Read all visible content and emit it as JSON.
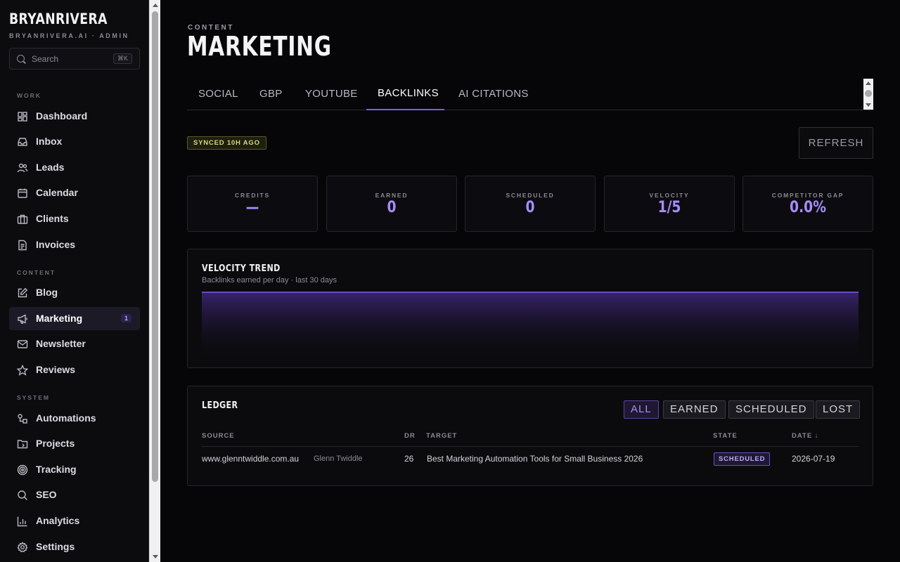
{
  "sidebar": {
    "brand": "BRYANRIVERA",
    "brand_sub": "BRYANRIVERA.AI · ADMIN",
    "search": {
      "placeholder": "Search",
      "shortcut": "⌘K"
    },
    "sections": [
      {
        "label": "WORK",
        "items": [
          {
            "label": "Dashboard",
            "icon": "dashboard-icon"
          },
          {
            "label": "Inbox",
            "icon": "inbox-icon"
          },
          {
            "label": "Leads",
            "icon": "users-icon"
          },
          {
            "label": "Calendar",
            "icon": "calendar-icon"
          },
          {
            "label": "Clients",
            "icon": "briefcase-icon"
          },
          {
            "label": "Invoices",
            "icon": "document-icon"
          }
        ]
      },
      {
        "label": "CONTENT",
        "items": [
          {
            "label": "Blog",
            "icon": "edit-icon"
          },
          {
            "label": "Marketing",
            "icon": "megaphone-icon",
            "active": true,
            "badge": "1"
          },
          {
            "label": "Newsletter",
            "icon": "mail-icon"
          },
          {
            "label": "Reviews",
            "icon": "star-icon"
          }
        ]
      },
      {
        "label": "SYSTEM",
        "items": [
          {
            "label": "Automations",
            "icon": "workflow-icon"
          },
          {
            "label": "Projects",
            "icon": "folder-icon"
          },
          {
            "label": "Tracking",
            "icon": "target-icon"
          },
          {
            "label": "SEO",
            "icon": "search-icon"
          },
          {
            "label": "Analytics",
            "icon": "chart-icon"
          },
          {
            "label": "Settings",
            "icon": "gear-icon"
          }
        ]
      }
    ]
  },
  "header": {
    "eyebrow": "CONTENT",
    "title": "MARKETING"
  },
  "tabs": [
    {
      "label": "SOCIAL"
    },
    {
      "label": "GBP"
    },
    {
      "label": "YOUTUBE"
    },
    {
      "label": "BACKLINKS",
      "active": true
    },
    {
      "label": "AI CITATIONS"
    }
  ],
  "sync_status": "SYNCED 10H AGO",
  "refresh_label": "REFRESH",
  "stats": [
    {
      "label": "CREDITS",
      "value": "—"
    },
    {
      "label": "EARNED",
      "value": "0"
    },
    {
      "label": "SCHEDULED",
      "value": "0"
    },
    {
      "label": "VELOCITY",
      "value": "1/5"
    },
    {
      "label": "COMPETITOR GAP",
      "value": "0.0%"
    }
  ],
  "velocity_card": {
    "title": "VELOCITY TREND",
    "subtitle": "Backlinks earned per day · last 30 days"
  },
  "chart_data": {
    "type": "area",
    "title": "VELOCITY TREND",
    "subtitle": "Backlinks earned per day · last 30 days",
    "series": [
      {
        "values": [
          0,
          0,
          0,
          0,
          0,
          0,
          0,
          0,
          0,
          0,
          0,
          0,
          0,
          0,
          0,
          0,
          0,
          0,
          0,
          0,
          0,
          0,
          0,
          0,
          0,
          0,
          0,
          0,
          0,
          0
        ]
      }
    ],
    "colors": {
      "line": "#7a5cf0",
      "fill": "#3a2470"
    }
  },
  "ledger": {
    "title": "LEDGER",
    "filters": [
      {
        "label": "ALL",
        "active": true
      },
      {
        "label": "EARNED"
      },
      {
        "label": "SCHEDULED"
      },
      {
        "label": "LOST"
      }
    ],
    "columns": [
      "SOURCE",
      "DR",
      "TARGET",
      "STATE",
      "DATE ↓"
    ],
    "rows": [
      {
        "source": "www.glenntwiddle.com.au",
        "source_name": "Glenn Twiddle",
        "dr": "26",
        "target": "Best Marketing Automation Tools for Small Business 2026",
        "state": "SCHEDULED",
        "date": "2026-07-19"
      }
    ]
  },
  "colors": {
    "accent": "#7a5cf0",
    "accent_text": "#a88cff",
    "bg": "#060608"
  }
}
